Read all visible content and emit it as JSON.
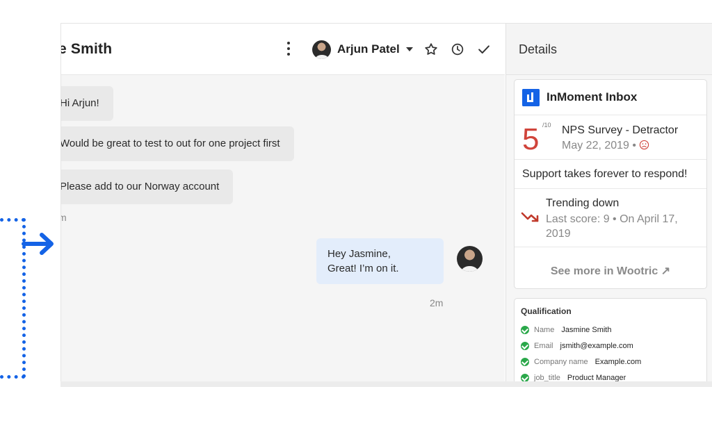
{
  "header": {
    "contact_name": "e Smith",
    "assignee": "Arjun Patel"
  },
  "messages_in": [
    {
      "text": "Hi Arjun!"
    },
    {
      "text": "Would be great to test to out for one project first"
    },
    {
      "text": "Please add to our Norway account"
    }
  ],
  "incoming_time": "m",
  "message_out": {
    "line1": "Hey Jasmine,",
    "line2": "Great! I’m on it.",
    "time": "2m"
  },
  "details": {
    "title": "Details",
    "brand": "InMoment Inbox",
    "score": "5",
    "score_max": "/10",
    "survey_title": "NPS Survey - Detractor",
    "survey_date": "May 22, 2019 •",
    "comment": "Support takes forever to respond!",
    "trend_title": "Trending down",
    "trend_sub": "Last score: 9 • On April 17, 2019",
    "see_more": "See more in Wootric ↗",
    "colors": {
      "brand": "#1463e6",
      "score": "#d0443b",
      "check": "#2aa84a"
    }
  },
  "qualification": {
    "title": "Qualification",
    "fields": [
      {
        "key": "Name",
        "value": "Jasmine Smith"
      },
      {
        "key": "Email",
        "value": "jsmith@example.com"
      },
      {
        "key": "Company name",
        "value": "Example.com"
      },
      {
        "key": "job_title",
        "value": "Product Manager"
      }
    ]
  },
  "icons": [
    "kebab-icon",
    "star-icon",
    "clock-icon",
    "check-icon",
    "arrow-right-icon",
    "sad-face-icon",
    "trending-down-icon"
  ]
}
